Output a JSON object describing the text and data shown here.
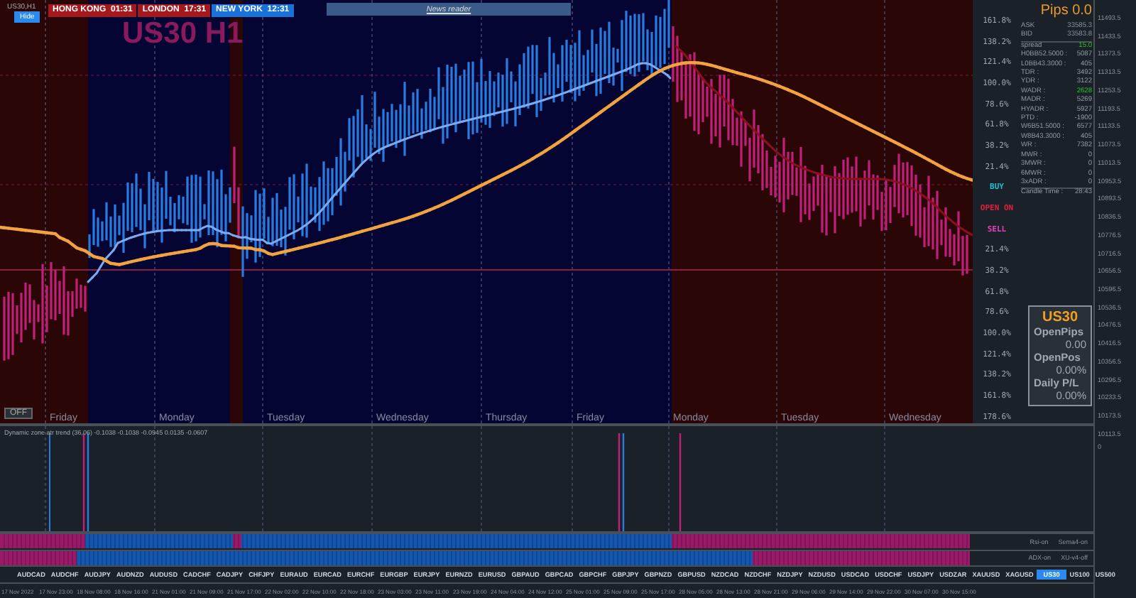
{
  "chart": {
    "symbol": "US30,H1",
    "hide_button": "Hide",
    "title": "US30 H1",
    "news_reader": "News reader",
    "off_button": "OFF",
    "sessions": [
      {
        "name": "HONG KONG",
        "time": "01:31",
        "active": false
      },
      {
        "name": "LONDON",
        "time": "17:31",
        "active": false
      },
      {
        "name": "NEW YORK",
        "time": "12:31",
        "active": true
      }
    ],
    "days": [
      "Friday",
      "Monday",
      "Tuesday",
      "Wednesday",
      "Thursday",
      "Friday",
      "Monday",
      "Tuesday",
      "Wednesday"
    ]
  },
  "info_panel": {
    "pips": "Pips 0.0",
    "ask_label": "ASK",
    "ask": "33585.3",
    "bid_label": "BID",
    "bid": "33583.8",
    "spread_label": "spread",
    "spread": "15.0",
    "stats": [
      {
        "label": "H0BB52.5000 :",
        "value": "5087",
        "positive": false
      },
      {
        "label": "L0BB43.3000 :",
        "value": "405",
        "positive": false
      },
      {
        "label": "TDR :",
        "value": "3492",
        "positive": false
      },
      {
        "label": "YDR :",
        "value": "3122",
        "positive": false
      },
      {
        "label": "WADR :",
        "value": "2628",
        "positive": true
      },
      {
        "label": "MADR :",
        "value": "5269",
        "positive": false
      },
      {
        "label": "HYADR :",
        "value": "5927",
        "positive": false
      },
      {
        "label": "PTD :",
        "value": "-1900",
        "positive": false
      },
      {
        "label": "W6B51.5000 :",
        "value": "6577",
        "positive": false
      },
      {
        "label": "W8B43.3000 :",
        "value": "405",
        "positive": false
      },
      {
        "label": "WR :",
        "value": "7382",
        "positive": false
      },
      {
        "label": "MWR :",
        "value": "0",
        "positive": false
      },
      {
        "label": "3MWR :",
        "value": "0",
        "positive": false
      },
      {
        "label": "6MWR :",
        "value": "0",
        "positive": false
      },
      {
        "label": "3xADR :",
        "value": "0",
        "positive": false
      }
    ],
    "candle_time_label": "Candle Time :",
    "candle_time": "28:43"
  },
  "levels": [
    {
      "kind": "fib",
      "text": "161.8%"
    },
    {
      "kind": "fib",
      "text": "138.2%"
    },
    {
      "kind": "fib",
      "text": "121.4%"
    },
    {
      "kind": "fib",
      "text": "100.0%"
    },
    {
      "kind": "fib",
      "text": "78.6%"
    },
    {
      "kind": "fib",
      "text": "61.8%"
    },
    {
      "kind": "fib",
      "text": "38.2%"
    },
    {
      "kind": "fib",
      "text": "21.4%"
    },
    {
      "kind": "buy",
      "text": "BUY"
    },
    {
      "kind": "open",
      "text": "OPEN ON"
    },
    {
      "kind": "sell",
      "text": "SELL"
    },
    {
      "kind": "fib",
      "text": "21.4%"
    },
    {
      "kind": "fib",
      "text": "38.2%"
    },
    {
      "kind": "fib",
      "text": "61.8%"
    },
    {
      "kind": "fib",
      "text": "78.6%"
    },
    {
      "kind": "fib",
      "text": "100.0%"
    },
    {
      "kind": "fib",
      "text": "121.4%"
    },
    {
      "kind": "fib",
      "text": "138.2%"
    },
    {
      "kind": "fib",
      "text": "161.8%"
    },
    {
      "kind": "fib",
      "text": "178.6%"
    }
  ],
  "position_card": {
    "symbol": "US30",
    "rows": [
      {
        "label": "OpenPips",
        "value": "0.00"
      },
      {
        "label": "OpenPos",
        "value": "0.00%"
      },
      {
        "label": "Daily P/L",
        "value": "0.00%"
      }
    ]
  },
  "price_axis": [
    "11493.5",
    "11433.5",
    "11373.5",
    "11313.5",
    "11253.5",
    "11193.5",
    "11133.5",
    "11073.5",
    "11013.5",
    "10953.5",
    "10893.5",
    "10836.5",
    "10776.5",
    "10716.5",
    "10656.5",
    "10596.5",
    "10536.5",
    "10476.5",
    "10416.5",
    "10356.5",
    "10296.5",
    "10233.5",
    "10173.5",
    "10113.5"
  ],
  "indicator": {
    "legend": "Dynamic zone atr trend (36,06) -0.1038 -0.1038 -0.0945 0.0135 -0.0607",
    "scale": "0"
  },
  "toggles": [
    [
      {
        "label": "Rsi-on"
      },
      {
        "label": "Sema4-on"
      }
    ],
    [
      {
        "label": "ADX-on"
      },
      {
        "label": "XU-v4-off"
      }
    ]
  ],
  "symbols": [
    {
      "name": "AUDCAD",
      "selected": false
    },
    {
      "name": "AUDCHF",
      "selected": false
    },
    {
      "name": "AUDJPY",
      "selected": false
    },
    {
      "name": "AUDNZD",
      "selected": false
    },
    {
      "name": "AUDUSD",
      "selected": false
    },
    {
      "name": "CADCHF",
      "selected": false
    },
    {
      "name": "CADJPY",
      "selected": false
    },
    {
      "name": "CHFJPY",
      "selected": false
    },
    {
      "name": "EURAUD",
      "selected": false
    },
    {
      "name": "EURCAD",
      "selected": false
    },
    {
      "name": "EURCHF",
      "selected": false
    },
    {
      "name": "EURGBP",
      "selected": false
    },
    {
      "name": "EURJPY",
      "selected": false
    },
    {
      "name": "EURNZD",
      "selected": false
    },
    {
      "name": "EURUSD",
      "selected": false
    },
    {
      "name": "GBPAUD",
      "selected": false
    },
    {
      "name": "GBPCAD",
      "selected": false
    },
    {
      "name": "GBPCHF",
      "selected": false
    },
    {
      "name": "GBPJPY",
      "selected": false
    },
    {
      "name": "GBPNZD",
      "selected": false
    },
    {
      "name": "GBPUSD",
      "selected": false
    },
    {
      "name": "NZDCAD",
      "selected": false
    },
    {
      "name": "NZDCHF",
      "selected": false
    },
    {
      "name": "NZDJPY",
      "selected": false
    },
    {
      "name": "NZDUSD",
      "selected": false
    },
    {
      "name": "USDCAD",
      "selected": false
    },
    {
      "name": "USDCHF",
      "selected": false
    },
    {
      "name": "USDJPY",
      "selected": false
    },
    {
      "name": "USDZAR",
      "selected": false
    },
    {
      "name": "XAUUSD",
      "selected": false
    },
    {
      "name": "XAGUSD",
      "selected": false
    },
    {
      "name": "US30",
      "selected": true
    },
    {
      "name": "US100",
      "selected": false
    },
    {
      "name": "US500",
      "selected": false
    }
  ],
  "time_axis": [
    "17 Nov 2022",
    "17 Nov 23:00",
    "18 Nov 08:00",
    "18 Nov 16:00",
    "21 Nov 01:00",
    "21 Nov 09:00",
    "21 Nov 17:00",
    "22 Nov 02:00",
    "22 Nov 10:00",
    "22 Nov 18:00",
    "23 Nov 03:00",
    "23 Nov 11:00",
    "23 Nov 19:00",
    "24 Nov 04:00",
    "24 Nov 12:00",
    "25 Nov 01:00",
    "25 Nov 09:00",
    "25 Nov 17:00",
    "28 Nov 05:00",
    "28 Nov 13:00",
    "28 Nov 21:00",
    "29 Nov 06:00",
    "29 Nov 14:00",
    "29 Nov 22:00",
    "30 Nov 07:00",
    "30 Nov 15:00"
  ]
}
